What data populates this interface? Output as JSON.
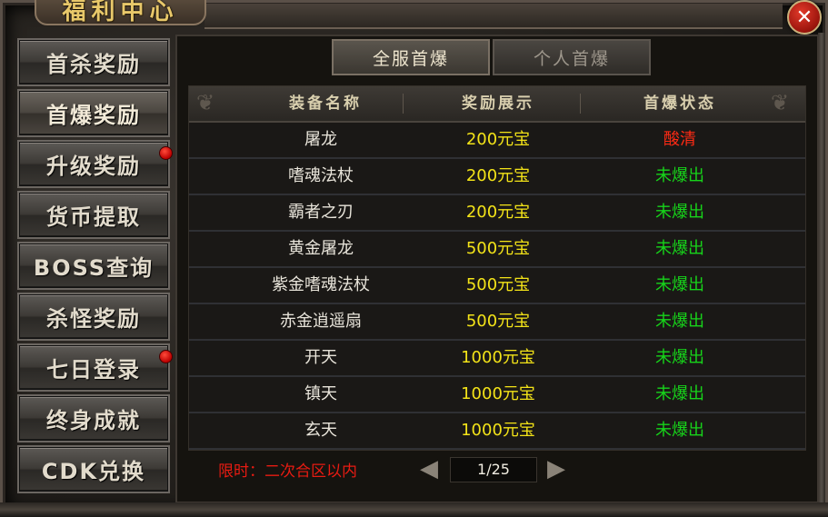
{
  "window": {
    "title": "福利中心",
    "close_symbol": "✕"
  },
  "sidebar": {
    "items": [
      {
        "label": "首杀奖励",
        "badge": false
      },
      {
        "label": "首爆奖励",
        "badge": false,
        "active": true
      },
      {
        "label": "升级奖励",
        "badge": true
      },
      {
        "label": "货币提取",
        "badge": false
      },
      {
        "label": "BOSS查询",
        "badge": false
      },
      {
        "label": "杀怪奖励",
        "badge": false
      },
      {
        "label": "七日登录",
        "badge": true
      },
      {
        "label": "终身成就",
        "badge": false
      },
      {
        "label": "CDK兑换",
        "badge": false
      }
    ]
  },
  "tabs": [
    {
      "label": "全服首爆",
      "active": true
    },
    {
      "label": "个人首爆",
      "active": false
    }
  ],
  "table": {
    "headers": [
      "装备名称",
      "奖励展示",
      "首爆状态"
    ],
    "rows": [
      {
        "name": "屠龙",
        "reward": "200元宝",
        "status": "酸清",
        "cleared": true
      },
      {
        "name": "嗜魂法杖",
        "reward": "200元宝",
        "status": "未爆出",
        "cleared": false
      },
      {
        "name": "霸者之刃",
        "reward": "200元宝",
        "status": "未爆出",
        "cleared": false
      },
      {
        "name": "黄金屠龙",
        "reward": "500元宝",
        "status": "未爆出",
        "cleared": false
      },
      {
        "name": "紫金嗜魂法杖",
        "reward": "500元宝",
        "status": "未爆出",
        "cleared": false
      },
      {
        "name": "赤金逍遥扇",
        "reward": "500元宝",
        "status": "未爆出",
        "cleared": false
      },
      {
        "name": "开天",
        "reward": "1000元宝",
        "status": "未爆出",
        "cleared": false
      },
      {
        "name": "镇天",
        "reward": "1000元宝",
        "status": "未爆出",
        "cleared": false
      },
      {
        "name": "玄天",
        "reward": "1000元宝",
        "status": "未爆出",
        "cleared": false
      }
    ]
  },
  "footer": {
    "limit_text": "限时：二次合区以内",
    "page": "1/25",
    "prev_icon": "prev-arrow-icon",
    "next_icon": "next-arrow-icon"
  },
  "colors": {
    "reward": "#f3e318",
    "status_pending": "#17d31a",
    "status_cleared": "#ff2a14",
    "limit_text": "#e81b12"
  }
}
